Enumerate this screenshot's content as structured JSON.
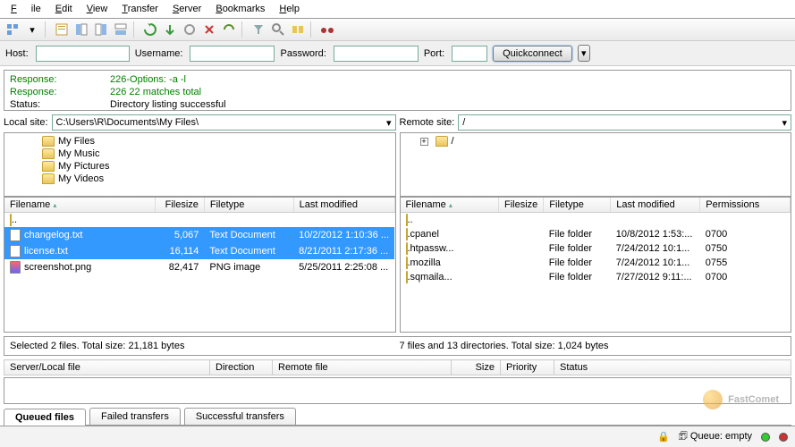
{
  "menu": {
    "file": "File",
    "edit": "Edit",
    "view": "View",
    "transfer": "Transfer",
    "server": "Server",
    "bookmarks": "Bookmarks",
    "help": "Help"
  },
  "quickbar": {
    "host": "Host:",
    "username": "Username:",
    "password": "Password:",
    "port": "Port:",
    "quickconnect": "Quickconnect"
  },
  "log": {
    "r1_label": "Response:",
    "r1_text": "226-Options: -a -l",
    "r2_label": "Response:",
    "r2_text": "226 22 matches total",
    "s_label": "Status:",
    "s_text": "Directory listing successful"
  },
  "local": {
    "label": "Local site:",
    "path": "C:\\Users\\R\\Documents\\My Files\\",
    "tree": [
      "My Files",
      "My Music",
      "My Pictures",
      "My Videos"
    ],
    "cols": {
      "name": "Filename",
      "size": "Filesize",
      "type": "Filetype",
      "mod": "Last modified"
    },
    "up": "..",
    "rows": [
      {
        "name": "changelog.txt",
        "size": "5,067",
        "type": "Text Document",
        "mod": "10/2/2012 1:10:36 ...",
        "sel": true
      },
      {
        "name": "license.txt",
        "size": "16,114",
        "type": "Text Document",
        "mod": "8/21/2011 2:17:36 ...",
        "sel": true
      },
      {
        "name": "screenshot.png",
        "size": "82,417",
        "type": "PNG image",
        "mod": "5/25/2011 2:25:08 ...",
        "sel": false
      }
    ],
    "status": "Selected 2 files. Total size: 21,181 bytes"
  },
  "remote": {
    "label": "Remote site:",
    "path": "/",
    "tree": [
      "/"
    ],
    "cols": {
      "name": "Filename",
      "size": "Filesize",
      "type": "Filetype",
      "mod": "Last modified",
      "perm": "Permissions"
    },
    "up": "..",
    "rows": [
      {
        "name": ".cpanel",
        "size": "",
        "type": "File folder",
        "mod": "10/8/2012 1:53:...",
        "perm": "0700"
      },
      {
        "name": ".htpassw...",
        "size": "",
        "type": "File folder",
        "mod": "7/24/2012 10:1...",
        "perm": "0750"
      },
      {
        "name": ".mozilla",
        "size": "",
        "type": "File folder",
        "mod": "7/24/2012 10:1...",
        "perm": "0755"
      },
      {
        "name": ".sqmaila...",
        "size": "",
        "type": "File folder",
        "mod": "7/27/2012 9:11:...",
        "perm": "0700"
      }
    ],
    "status": "7 files and 13 directories. Total size: 1,024 bytes"
  },
  "queue_cols": {
    "file": "Server/Local file",
    "dir": "Direction",
    "remote": "Remote file",
    "size": "Size",
    "prio": "Priority",
    "status": "Status"
  },
  "tabs": {
    "queued": "Queued files",
    "failed": "Failed transfers",
    "success": "Successful transfers"
  },
  "footer": {
    "queue": "Queue: empty"
  },
  "brand": "FastComet"
}
